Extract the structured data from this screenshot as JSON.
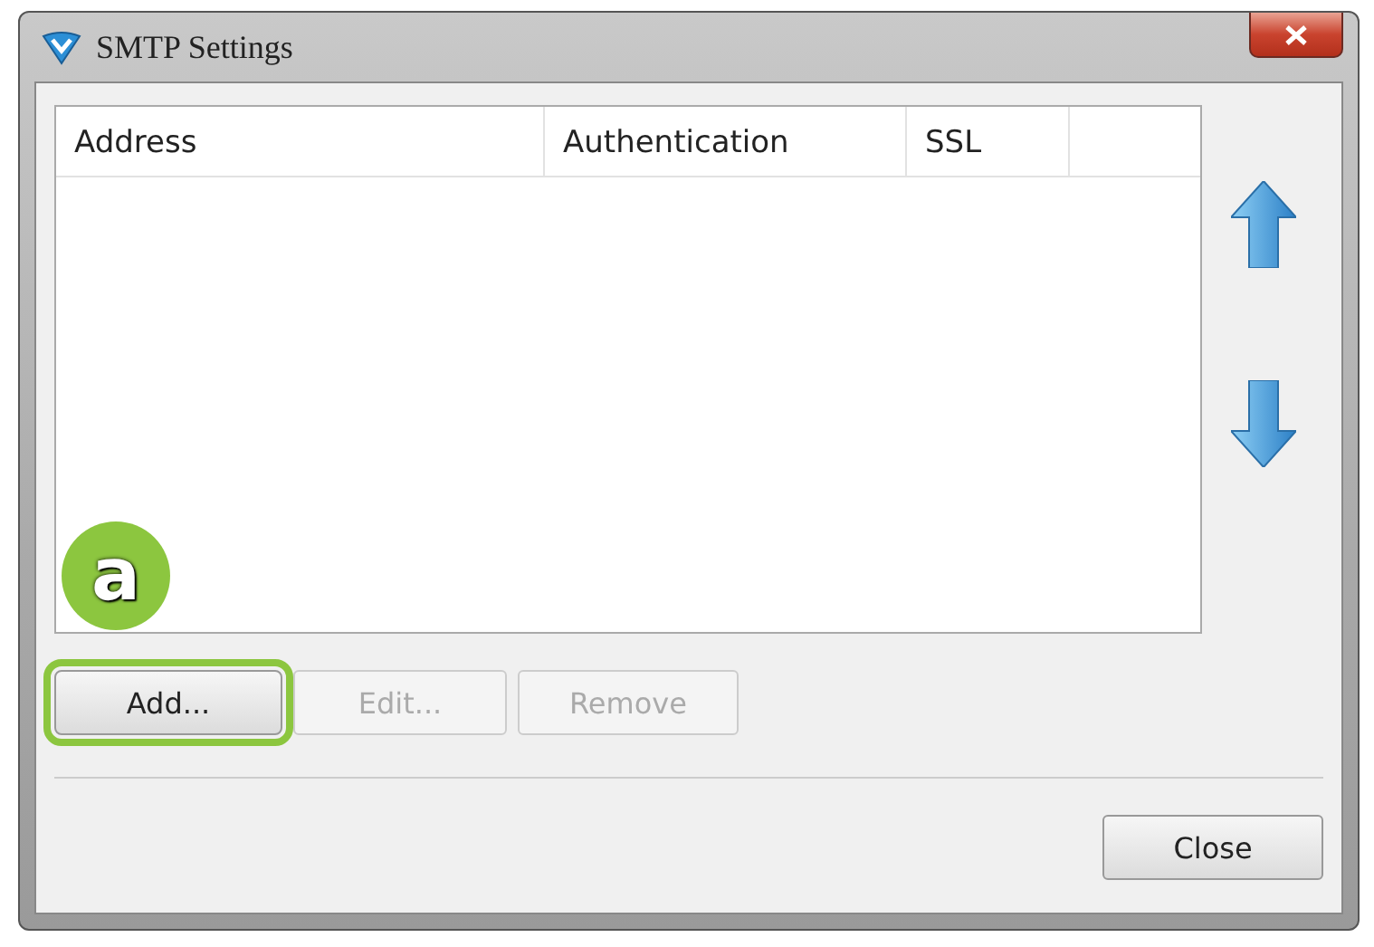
{
  "window": {
    "title": "SMTP Settings"
  },
  "table": {
    "columns": [
      {
        "label": "Address"
      },
      {
        "label": "Authentication"
      },
      {
        "label": "SSL"
      }
    ]
  },
  "buttons": [
    {
      "label": "Add...",
      "disabled": false,
      "highlighted": true
    },
    {
      "label": "Edit...",
      "disabled": true,
      "highlighted": false
    },
    {
      "label": "Remove",
      "disabled": true,
      "highlighted": false
    }
  ],
  "annotation": {
    "label": "a"
  },
  "footer_buttons": [
    {
      "label": "Close"
    }
  ]
}
